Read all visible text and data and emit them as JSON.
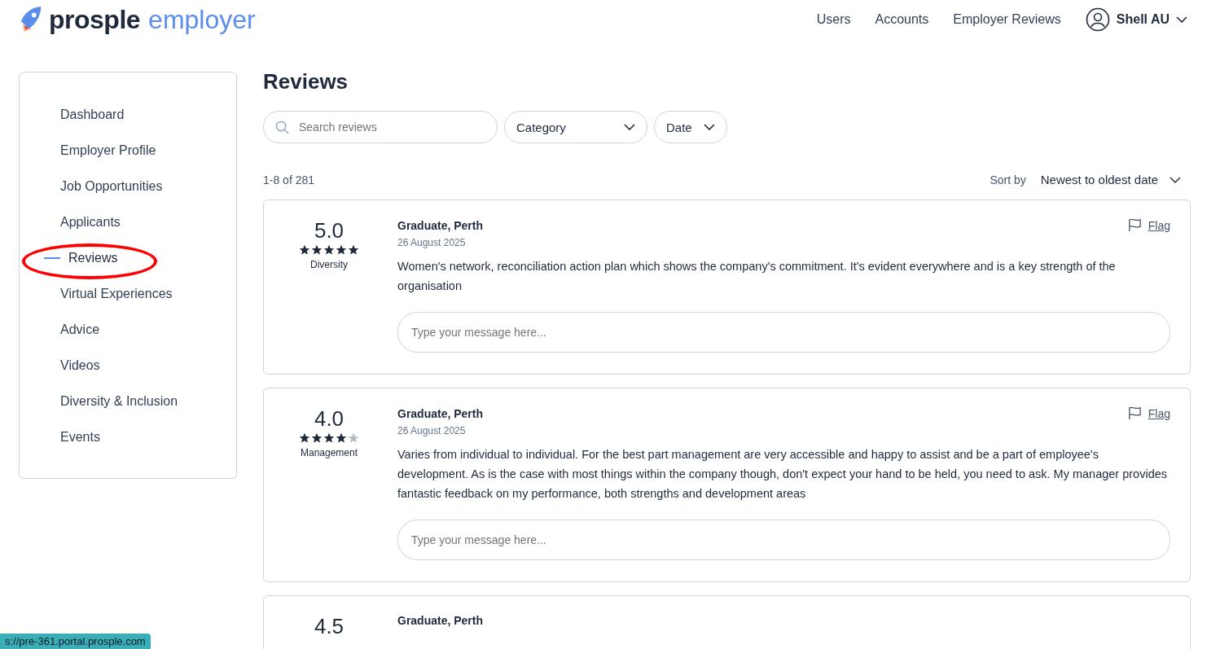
{
  "header": {
    "logo": {
      "brand": "prosple",
      "product": "employer"
    },
    "nav": [
      "Users",
      "Accounts",
      "Employer Reviews"
    ],
    "account": {
      "name": "Shell AU"
    }
  },
  "sidebar": {
    "items": [
      {
        "label": "Dashboard",
        "selected": false,
        "annotated": false
      },
      {
        "label": "Employer Profile",
        "selected": false,
        "annotated": false
      },
      {
        "label": "Job Opportunities",
        "selected": false,
        "annotated": false
      },
      {
        "label": "Applicants",
        "selected": false,
        "annotated": false
      },
      {
        "label": "Reviews",
        "selected": true,
        "annotated": true
      },
      {
        "label": "Virtual Experiences",
        "selected": false,
        "annotated": false
      },
      {
        "label": "Advice",
        "selected": false,
        "annotated": false
      },
      {
        "label": "Videos",
        "selected": false,
        "annotated": false
      },
      {
        "label": "Diversity & Inclusion",
        "selected": false,
        "annotated": false
      },
      {
        "label": "Events",
        "selected": false,
        "annotated": false
      }
    ]
  },
  "main": {
    "title": "Reviews",
    "search": {
      "placeholder": "Search reviews"
    },
    "filters": [
      "Category",
      "Date"
    ],
    "count": "1-8 of 281",
    "sort": {
      "label": "Sort by",
      "value": "Newest to oldest date"
    },
    "reviews": [
      {
        "score": "5.0",
        "stars": 5,
        "category": "Diversity",
        "role": "Graduate, Perth",
        "date": "26 August 2025",
        "flag": "Flag",
        "text": "Women's network, reconciliation action plan which shows the company's commitment. It's evident everywhere and is a key strength of the organisation",
        "reply": {
          "placeholder": "Type your message here..."
        }
      },
      {
        "score": "4.0",
        "stars": 4,
        "category": "Management",
        "role": "Graduate, Perth",
        "date": "26 August 2025",
        "flag": "Flag",
        "text": "Varies from individual to individual. For the best part management are very accessible and happy to assist and be a part of employee's development. As is the case with most things within the company though, don't expect your hand to be held, you need to ask. My manager provides fantastic feedback on my performance, both strengths and development areas",
        "reply": {
          "placeholder": "Type your message here..."
        }
      },
      {
        "score": "4.5",
        "role": "Graduate, Perth"
      }
    ]
  },
  "status_url": "s://pre-361.portal.prosple.com"
}
